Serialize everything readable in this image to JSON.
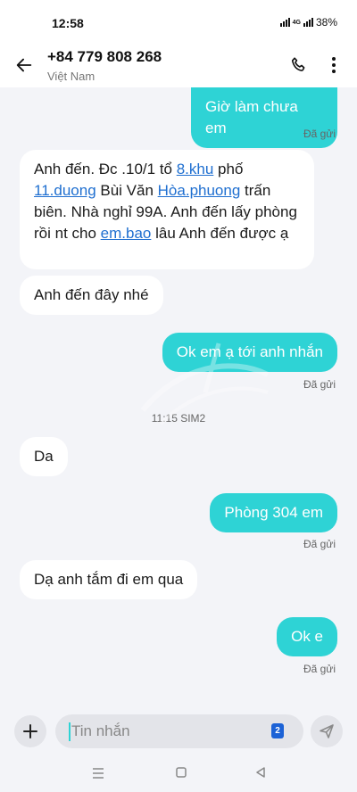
{
  "status_bar": {
    "time": "12:58",
    "network": "4G",
    "battery": "38%"
  },
  "header": {
    "phone": "+84 779 808 268",
    "country": "Việt Nam"
  },
  "messages": [
    {
      "text": "Giờ làm chưa em",
      "status": "Đã gửi"
    },
    {
      "t1": "Anh đến. Đc .10/1 tổ ",
      "l1": "8.khu",
      "t2": " phố ",
      "l2": "11.duong",
      "t3": " Bùi Văn ",
      "l3": "Hòa.phuong",
      "t4": " trấn biên. Nhà nghỉ 99A. Anh đến lấy phòng rồi nt cho ",
      "l4": "em.bao",
      "t5": " lâu Anh đến được ạ"
    },
    {
      "text": "Anh đến đây nhé"
    },
    {
      "text": "Ok em ạ tới anh nhắn",
      "status": "Đã gửi"
    },
    {
      "text": "Da"
    },
    {
      "text": "Phòng 304 em",
      "status": "Đã gửi"
    },
    {
      "text": "Dạ anh tắm đi em qua"
    },
    {
      "text": "Ok e",
      "status": "Đã gửi"
    }
  ],
  "timestamp": "11:15 SIM2",
  "composer": {
    "placeholder": "Tin nhắn",
    "sim": "2"
  }
}
